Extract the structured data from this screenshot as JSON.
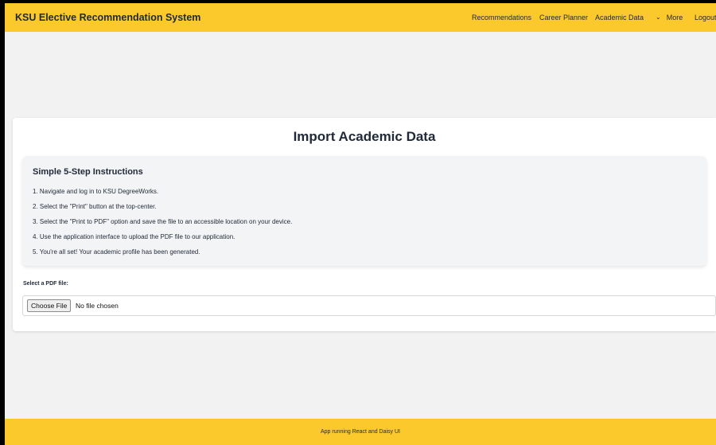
{
  "navbar": {
    "brand": "KSU Elective Recommendation System",
    "links": [
      "Recommendations",
      "Career Planner",
      "Academic Data"
    ],
    "more_label": "More",
    "logout_label": "Logout"
  },
  "card": {
    "title": "Import Academic Data",
    "instructions": {
      "title": "Simple 5-Step Instructions",
      "steps": [
        "1. Navigate and log in to KSU DegreeWorks.",
        "2. Select the \"Print\" button at the top-center.",
        "3. Select the \"Print to PDF\" option and save the file to an accessible location on your device.",
        "4. Use the application interface to upload the PDF file to our application.",
        "5. You're all set! Your academic profile has been generated."
      ]
    },
    "file": {
      "label": "Select a PDF file:",
      "button_label": "Choose File",
      "status": "No file chosen"
    }
  },
  "footer": {
    "text": "App running React and Daisy UI"
  }
}
